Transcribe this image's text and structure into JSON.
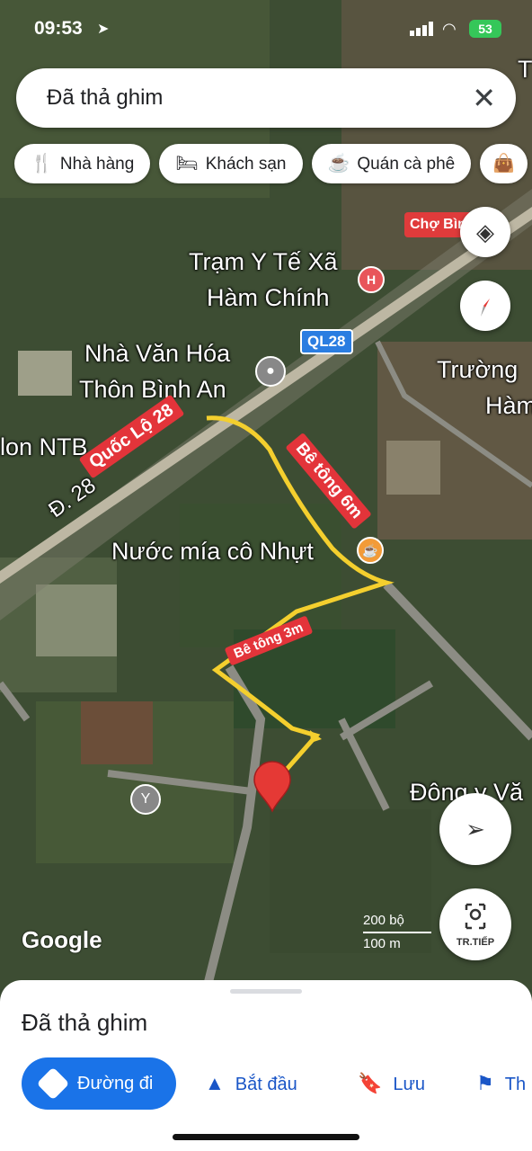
{
  "status": {
    "time": "09:53",
    "battery": "53"
  },
  "search": {
    "query": "Đã thả ghim"
  },
  "chips": [
    {
      "icon": "restaurant-icon",
      "label": "Nhà hàng"
    },
    {
      "icon": "hotel-icon",
      "label": "Khách sạn"
    },
    {
      "icon": "coffee-icon",
      "label": "Quán cà phê"
    }
  ],
  "map": {
    "labels": {
      "cho": "Chợ Bình An",
      "tram": "Trạm Y Tế Xã",
      "tram2": "Hàm Chính",
      "nha_van_hoa": "Nhà Văn Hóa",
      "thon": "Thôn Bình An",
      "truong": "Trường",
      "truong2": "Hàm",
      "lon": "lon NTB",
      "d28": "Đ. 28",
      "nuoc_mia": "Nước mía cô Nhựt",
      "dong_y": "Đông y Vă",
      "t": "T"
    },
    "shield": "QL28",
    "annotations": {
      "quoc_lo": "Quốc Lộ 28",
      "be_tong_6m": "Bê tông 6m",
      "be_tong_3m": "Bê tông 3m"
    },
    "scale": {
      "feet": "200 bộ",
      "meters": "100 m"
    },
    "attribution": "Google"
  },
  "controls": {
    "next_label": "TR.TIẾP"
  },
  "sheet": {
    "title": "Đã thả ghim",
    "buttons": {
      "directions": "Đường đi",
      "start": "Bắt đầu",
      "save": "Lưu",
      "more": "Th"
    }
  }
}
